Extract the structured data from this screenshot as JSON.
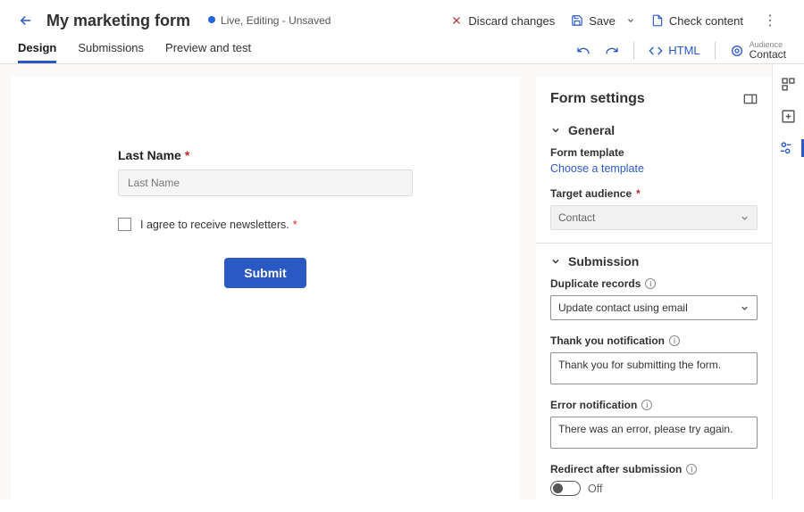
{
  "header": {
    "title": "My marketing form",
    "status": "Live, Editing - Unsaved",
    "actions": {
      "discard": "Discard changes",
      "save": "Save",
      "check": "Check content"
    }
  },
  "tabs": {
    "design": "Design",
    "submissions": "Submissions",
    "preview": "Preview and test",
    "html": "HTML",
    "audience_label": "Audience",
    "audience_value": "Contact"
  },
  "canvas": {
    "last_name_label": "Last Name",
    "last_name_placeholder": "Last Name",
    "newsletter_label": "I agree to receive newsletters.",
    "submit": "Submit"
  },
  "settings": {
    "title": "Form settings",
    "general": {
      "heading": "General",
      "form_template_label": "Form template",
      "choose_template": "Choose a template",
      "target_audience_label": "Target audience",
      "target_audience_value": "Contact"
    },
    "submission": {
      "heading": "Submission",
      "duplicate_label": "Duplicate records",
      "duplicate_value": "Update contact using email",
      "thankyou_label": "Thank you notification",
      "thankyou_value": "Thank you for submitting the form.",
      "error_label": "Error notification",
      "error_value": "There was an error, please try again.",
      "redirect_label": "Redirect after submission",
      "redirect_state": "Off"
    }
  }
}
